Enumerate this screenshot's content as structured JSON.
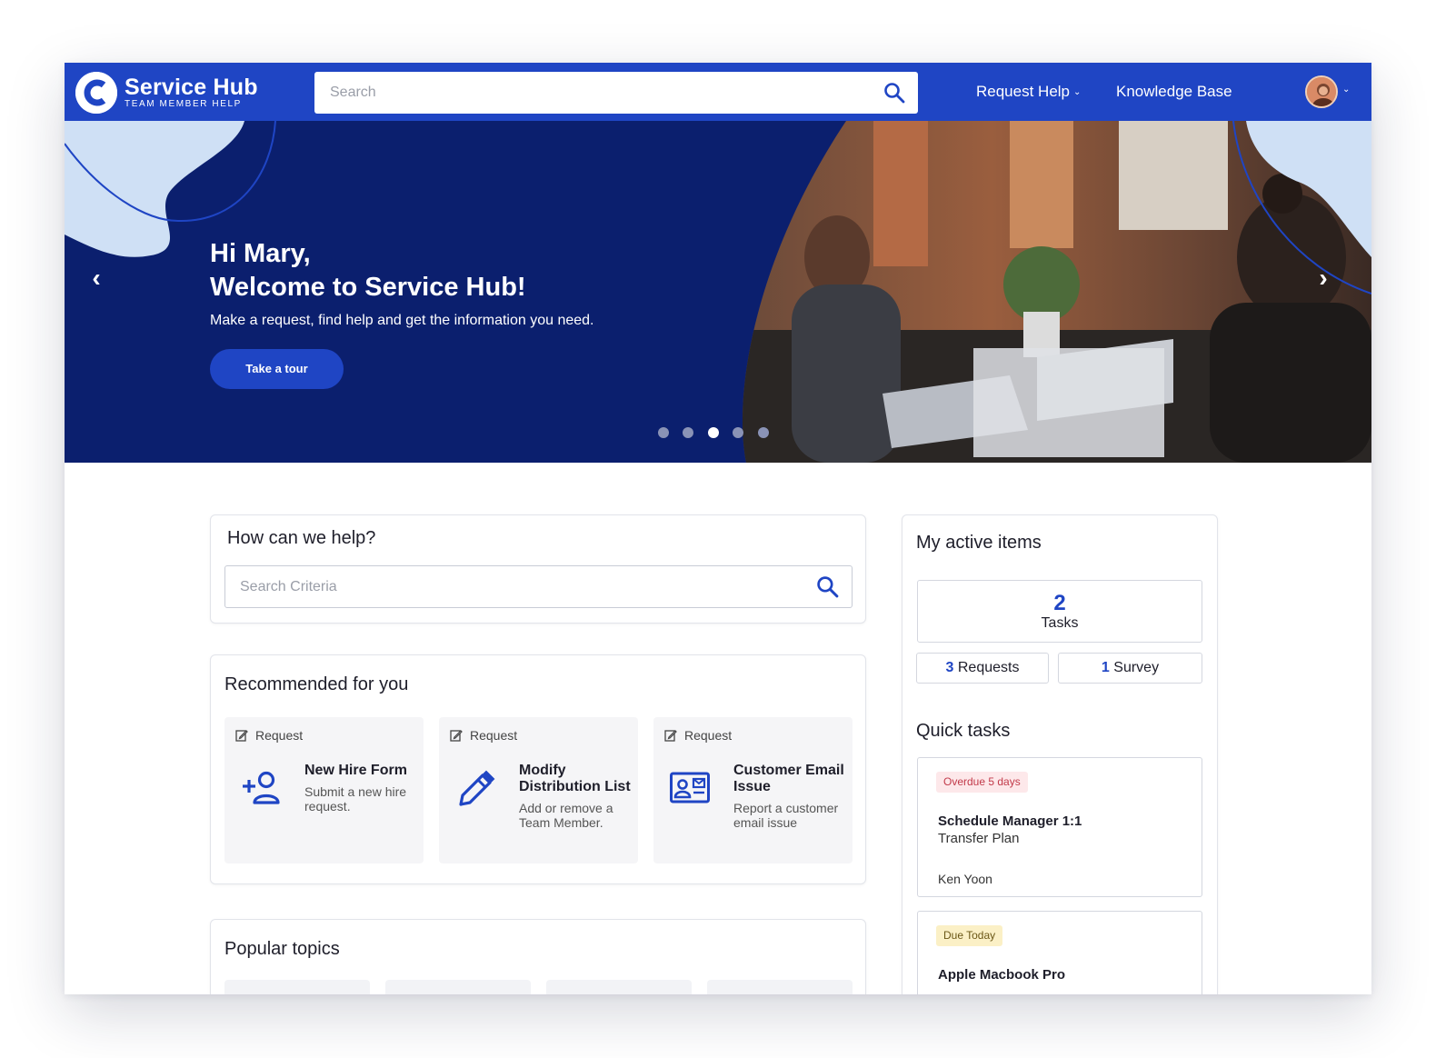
{
  "brand": {
    "name": "Service Hub",
    "tagline": "TEAM MEMBER HELP"
  },
  "top_search": {
    "placeholder": "Search"
  },
  "nav": {
    "request_help": "Request Help",
    "knowledge_base": "Knowledge Base"
  },
  "hero": {
    "greeting": "Hi Mary,",
    "welcome": "Welcome to Service Hub!",
    "subtitle": "Make a request, find help and get the information you need.",
    "button": "Take a tour",
    "slides": 5,
    "active_slide": 3
  },
  "help": {
    "title": "How can we help?",
    "placeholder": "Search Criteria"
  },
  "recommended": {
    "title": "Recommended for you",
    "items": [
      {
        "type": "Request",
        "title": "New Hire Form",
        "desc": "Submit a new hire request.",
        "icon": "add-user-icon"
      },
      {
        "type": "Request",
        "title": "Modify Distribution List",
        "desc": "Add or remove a Team Member.",
        "icon": "pencil-icon"
      },
      {
        "type": "Request",
        "title": "Customer Email Issue",
        "desc": "Report a customer email issue",
        "icon": "contact-card-icon"
      }
    ]
  },
  "popular": {
    "title": "Popular topics"
  },
  "active": {
    "title": "My active items",
    "tasks_count": "2",
    "tasks_label": "Tasks",
    "requests_count": "3",
    "requests_label": "Requests",
    "survey_count": "1",
    "survey_label": "Survey"
  },
  "quick": {
    "title": "Quick tasks",
    "items": [
      {
        "badge": "Overdue 5 days",
        "title": "Schedule Manager 1:1",
        "subtitle": "Transfer Plan",
        "person": "Ken Yoon"
      },
      {
        "badge": "Due Today",
        "title": "Apple Macbook Pro"
      }
    ]
  },
  "colors": {
    "primary": "#1f45c4",
    "hero_bg": "#0b1f6e",
    "overdue": "#c23a4a",
    "due_today": "#fbf0c6"
  }
}
